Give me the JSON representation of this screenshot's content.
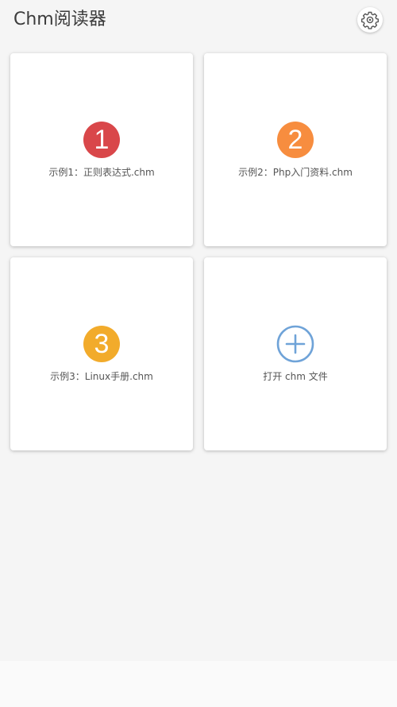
{
  "app_bar": {
    "title": "Chm阅读器",
    "settings_icon": "gear-icon"
  },
  "colors": {
    "background": "#f5f5f5",
    "card": "#ffffff",
    "badge_1": "#d9474a",
    "badge_2": "#f78d3f",
    "badge_3": "#f2ab2b",
    "add_icon": "#6fa3d8",
    "title_text": "#3c3c3c",
    "label_text": "#555555"
  },
  "cards": [
    {
      "badge": "1",
      "label": "示例1：正则表达式.chm"
    },
    {
      "badge": "2",
      "label": "示例2：Php入门资料.chm"
    },
    {
      "badge": "3",
      "label": "示例3：Linux手册.chm"
    },
    {
      "icon": "add-circle-icon",
      "label": "打开 chm 文件"
    }
  ]
}
